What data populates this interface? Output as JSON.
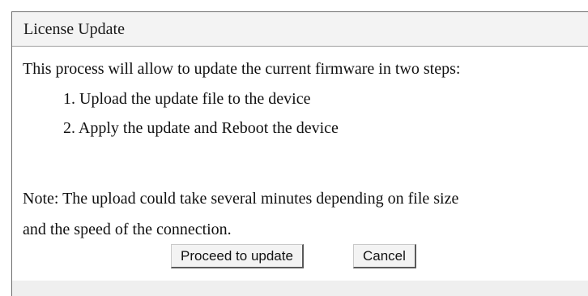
{
  "dialog": {
    "title": "License Update",
    "intro": "This process will allow to update the current firmware in two steps:",
    "steps": [
      "1. Upload the update file to the device",
      "2. Apply the update and Reboot the device"
    ],
    "note_lines": [
      "Note: The upload could take several minutes depending on file size",
      "and the speed of the connection."
    ],
    "buttons": {
      "proceed": "Proceed to update",
      "cancel": "Cancel"
    }
  },
  "colors": {
    "title_background": "#f3f3f3",
    "footer_background": "#efefef",
    "button_background": "#f3f3f3",
    "text": "#111111"
  }
}
